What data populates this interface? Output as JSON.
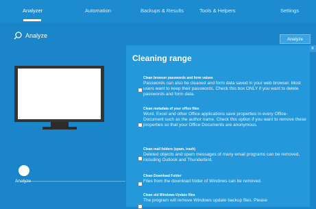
{
  "nav": {
    "tabs": [
      {
        "label": "Analyzer",
        "active": true
      },
      {
        "label": "Automation",
        "active": false
      },
      {
        "label": "Backups & Results",
        "active": false
      },
      {
        "label": "Tools & Helpers",
        "active": false
      },
      {
        "label": "Settings",
        "active": false
      }
    ]
  },
  "subbar": {
    "title": "Analyze",
    "button_label": "Analyze",
    "close_label": "x"
  },
  "left": {
    "step_label": "Analyze"
  },
  "panel": {
    "title": "Cleaning range",
    "items": [
      {
        "title": "Clean browser passwords and form values",
        "desc": "Passwords can also be cleaned and form data saved in your web browser. Most users want to keep their passwords. Check this box ONLY if you want to delete passwords and form data."
      },
      {
        "title": "Clean metadata of your office files",
        "desc": "Word, Excel and other Office applications save properties in every Office-Document such as the author name. Check this option if you want to remove these properties so that your Office Documents are anonymous."
      },
      {
        "title": "Clean mail folders (spam, trash)",
        "desc": "Deleted objects and spam messages of many email programs can be removed, including Outlook and Thunderbird."
      },
      {
        "title": "Clean Download Folder",
        "desc": "Files from the download folder of Windows can be removed."
      },
      {
        "title": "Clean old Windows Update files",
        "desc": "The program will remove Windows update backup files. Please"
      }
    ]
  },
  "colors": {
    "background": "#1a86c9",
    "panel": "#2598dc",
    "accent_button": "#3aa3e3"
  }
}
